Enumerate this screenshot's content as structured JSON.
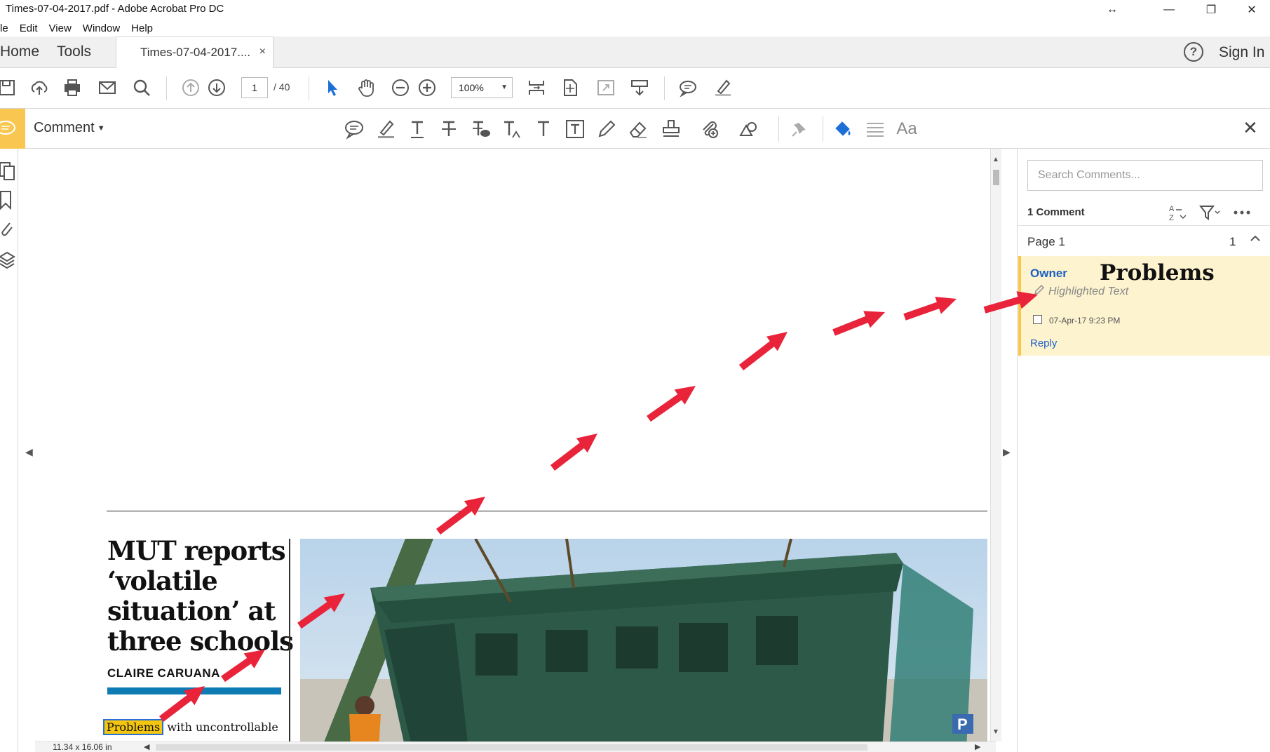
{
  "window": {
    "title": "Times-07-04-2017.pdf - Adobe Acrobat Pro DC",
    "controls": {
      "resize": "↔",
      "minimize": "—",
      "restore": "❐",
      "close": "✕"
    }
  },
  "menu": [
    "le",
    "Edit",
    "View",
    "Window",
    "Help"
  ],
  "tabs": {
    "home": "Home",
    "tools": "Tools",
    "document": "Times-07-04-2017....",
    "close": "×",
    "help": "?",
    "signin": "Sign In"
  },
  "toolbar": {
    "page_current": "1",
    "page_total": "/ 40",
    "zoom": "100%",
    "zoom_arrow": "▼"
  },
  "comment_bar": {
    "label": "Comment",
    "dropdown": "▼",
    "text_style": "Aa",
    "close": "✕"
  },
  "document": {
    "headline": "MUT reports ‘volatile situation’ at three schools",
    "byline": "CLAIRE CARUANA",
    "highlighted_word": "Problems",
    "body_start": "with uncontrollable",
    "page_size": "11.34 x 16.06 in"
  },
  "comments_panel": {
    "search_placeholder": "Search Comments...",
    "count": "1 Comment",
    "page_label": "Page 1",
    "page_count": "1",
    "comment": {
      "author": "Owner",
      "note": "Problems",
      "type": "Highlighted Text",
      "timestamp": "07-Apr-17  9:23 PM",
      "reply": "Reply"
    }
  },
  "colors": {
    "accent_yellow": "#f9c74f",
    "highlight": "#f4c60f",
    "link_blue": "#1a5fc6",
    "byline_bar": "#0e7bb5",
    "arrow_red": "#e8233a",
    "comment_card": "#fdf3cf"
  },
  "icons": [
    "save-icon",
    "upload-icon",
    "print-icon",
    "email-icon",
    "search-icon",
    "prev-page-icon",
    "next-page-icon",
    "select-arrow-icon",
    "hand-icon",
    "zoom-out-icon",
    "zoom-in-icon",
    "comment-icon",
    "highlight-icon",
    "text-icon",
    "strikethrough-icon",
    "pin-icon",
    "fill-color-icon"
  ]
}
